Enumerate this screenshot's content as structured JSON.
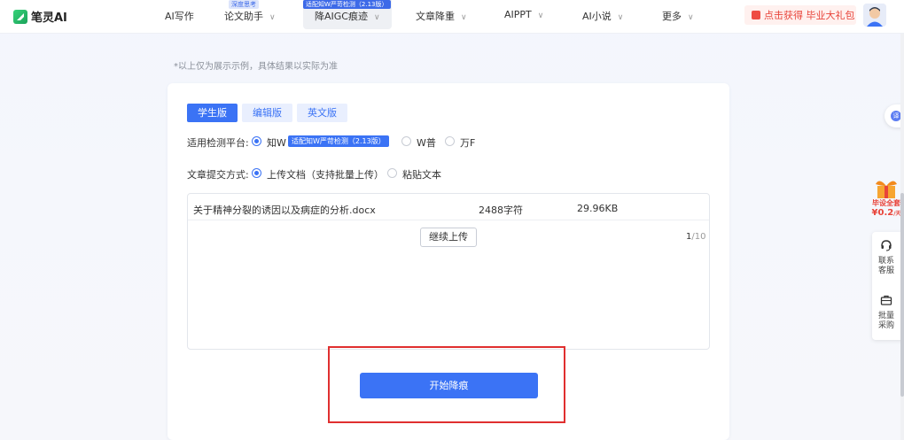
{
  "nav": {
    "brand": "笔灵AI",
    "items": [
      {
        "label": "AI写作",
        "chevron": false
      },
      {
        "label": "论文助手",
        "chevron": true,
        "badge": "深度思考"
      },
      {
        "label": "降AIGC痕迹",
        "chevron": true,
        "badge": "适配知W严苛检测（2.13版）",
        "active": true
      },
      {
        "label": "文章降重",
        "chevron": true
      },
      {
        "label": "AIPPT",
        "chevron": true
      },
      {
        "label": "AI小说",
        "chevron": true
      },
      {
        "label": "更多",
        "chevron": true
      }
    ],
    "promo": "点击获得 毕业大礼包"
  },
  "notice": "*以上仅为展示示例，具体结果以实际为准",
  "tabs": [
    "学生版",
    "编辑版",
    "英文版"
  ],
  "platform": {
    "label": "适用检测平台:",
    "options": [
      {
        "label": "知W",
        "selected": true,
        "tag": "适配知W严苛检测（2.13版）"
      },
      {
        "label": "W普",
        "selected": false
      },
      {
        "label": "万F",
        "selected": false
      }
    ]
  },
  "submit": {
    "label": "文章提交方式:",
    "options": [
      {
        "label": "上传文档（支持批量上传）",
        "selected": true
      },
      {
        "label": "粘贴文本",
        "selected": false
      }
    ]
  },
  "files": [
    {
      "name": "关于精神分裂的诱因以及病症的分析.docx",
      "chars": "2488字符",
      "size": "29.96KB"
    }
  ],
  "continue_label": "继续上传",
  "count": {
    "current": "1",
    "total": "/10"
  },
  "start_label": "开始降痕",
  "side": {
    "translate": "译",
    "promo_line1": "毕设全套",
    "promo_line2": "¥0.2",
    "promo_unit": "/天",
    "contact": "联系客服",
    "bulk": "批量采购"
  },
  "colors": {
    "accent": "#3b73f5",
    "highlight": "#e02f2f",
    "promo": "#e8443a"
  }
}
